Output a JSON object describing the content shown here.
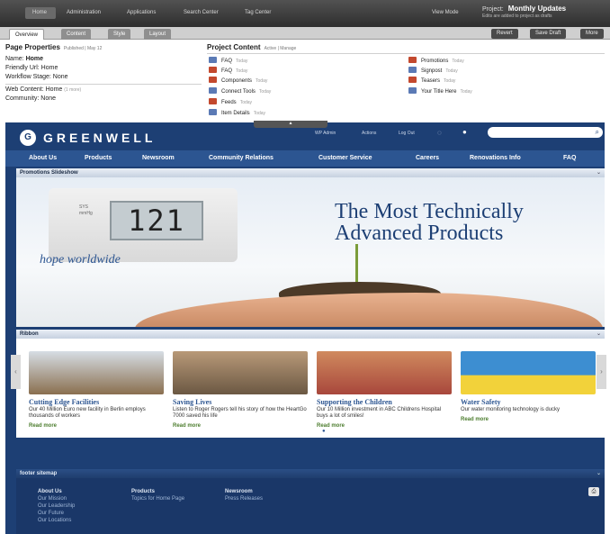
{
  "cms": {
    "nav": [
      "Home",
      "Administration",
      "Applications",
      "Search Center",
      "Tag Center",
      "View Mode"
    ],
    "project_label": "Project:",
    "project_name": "Monthly Updates",
    "project_note": "Edits are added to project as drafts",
    "tabs": [
      "Overview",
      "Content",
      "Style",
      "Layout"
    ],
    "actions": [
      "Revert",
      "Save Draft",
      "More"
    ]
  },
  "properties": {
    "title": "Page Properties",
    "meta": "Published | May 12",
    "name_label": "Name:",
    "name_value": "Home",
    "friendly_url": "Friendly Url: Home",
    "workflow": "Workflow Stage: None",
    "web_content": "Web Content: Home",
    "web_more": "(1 more)",
    "community": "Community: None"
  },
  "project_content": {
    "title": "Project Content",
    "meta": "Active | Manage",
    "left": [
      {
        "label": "FAQ",
        "time": "Today",
        "color": "#5b7ab5"
      },
      {
        "label": "FAQ",
        "time": "Today",
        "color": "#c3492e"
      },
      {
        "label": "Components",
        "time": "Today",
        "color": "#c3492e"
      },
      {
        "label": "Connect Tools",
        "time": "Today",
        "color": "#5b7ab5"
      },
      {
        "label": "Feeds",
        "time": "Today",
        "color": "#c3492e"
      },
      {
        "label": "Item Details",
        "time": "Today",
        "color": "#5b7ab5"
      }
    ],
    "right": [
      {
        "label": "Promotions",
        "time": "Today",
        "color": "#c3492e"
      },
      {
        "label": "Signpost",
        "time": "Today",
        "color": "#5b7ab5"
      },
      {
        "label": "Teasers",
        "time": "Today",
        "color": "#c3492e"
      },
      {
        "label": "Your Title Here",
        "time": "Today",
        "color": "#5b7ab5"
      }
    ]
  },
  "site": {
    "brand": "GREENWELL",
    "utility": [
      "WP Admin",
      "Actions",
      "Log Out"
    ],
    "nav": [
      "About Us",
      "Products",
      "Newsroom",
      "Community Relations",
      "Customer Service",
      "Careers",
      "Renovations Info",
      "FAQ"
    ],
    "promo_header": "Promotions Slideshow",
    "hero_headline_1": "The Most Technically",
    "hero_headline_2": "Advanced Products",
    "hero_tagline": "hope worldwide",
    "monitor_reading": "121",
    "monitor_label_1": "SYS",
    "monitor_label_2": "mmHg",
    "ribbon_header": "Ribbon",
    "cards": [
      {
        "title": "Cutting Edge Facilities",
        "desc": "Our 40 Million Euro new facility in Berlin employs thousands of workers",
        "more": "Read more",
        "color": "#8a6f4f"
      },
      {
        "title": "Saving Lives",
        "desc": "Listen to Roger Rogers tell his story of how the HeartGo 7000 saved his life",
        "more": "Read more",
        "color": "#9a7b5c"
      },
      {
        "title": "Supporting the Children",
        "desc": "Our 10 Million investment in ABC Childrens Hospital buys a lot of smiles!",
        "more": "Read more",
        "color": "#b35a4c"
      },
      {
        "title": "Water Safety",
        "desc": "Our water monitoring technology is ducky",
        "more": "Read more",
        "color": "#3d8ed1"
      }
    ],
    "footer_header": "footer sitemap",
    "footer_cols": [
      {
        "head": "About Us",
        "items": [
          "Our Mission",
          "Our Leadership",
          "Our Future",
          "Our Locations"
        ]
      },
      {
        "head": "Products",
        "items": [
          "Topics for Home Page"
        ]
      },
      {
        "head": "Newsroom",
        "items": [
          "Press Releases"
        ]
      }
    ]
  },
  "colors": {
    "site_blue": "#1d3f74",
    "nav_blue": "#2c5591",
    "link_green": "#4c7d2e"
  }
}
